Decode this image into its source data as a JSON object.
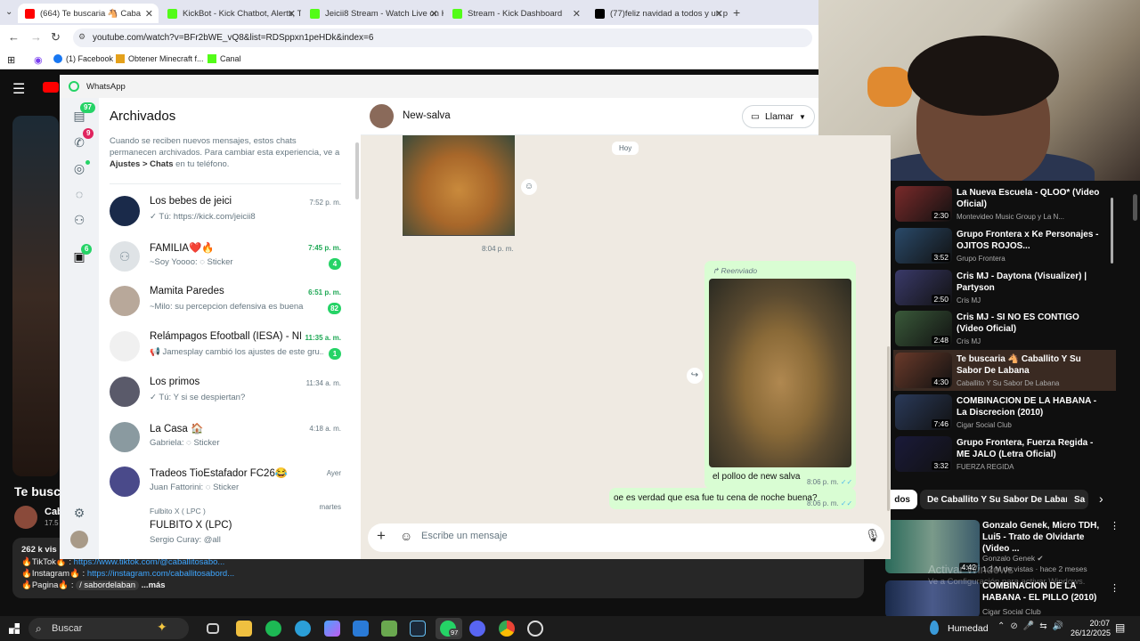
{
  "browser": {
    "tabs": [
      {
        "label": "(664) Te buscaria 🐴 Caba",
        "active": true,
        "color": "#ff0000"
      },
      {
        "label": "KickBot - Kick Chatbot, Alerts, T",
        "active": false,
        "color": "#53fc18"
      },
      {
        "label": "Jeicii8 Stream - Watch Live on K",
        "active": false,
        "color": "#53fc18"
      },
      {
        "label": "Stream - Kick Dashboard",
        "active": false,
        "color": "#53fc18"
      },
      {
        "label": "(77)feliz navidad a todos y un p",
        "active": false,
        "color": "#000000"
      }
    ],
    "url": "youtube.com/watch?v=BFr2bWE_vQ8&list=RDSppxn1peHDk&index=6",
    "bookmarks": [
      "(1) Facebook",
      "Obtener Minecraft f...",
      "Canal"
    ]
  },
  "youtube": {
    "title": "Te busca",
    "channel": "Cab",
    "channel_sub": "17.5",
    "views": "262 k vis",
    "desc_lines": [
      {
        "prefix": "🔥TikTok🔥 : ",
        "link": "https://www.tiktok.com/@caballitosabo..."
      },
      {
        "prefix": "🔥Instagram🔥 : ",
        "link": "https://instagram.com/caballitosabord..."
      },
      {
        "prefix": "🔥Pagina🔥 : ",
        "link": "/ sabordelaban"
      }
    ],
    "more": "...más",
    "playlist": [
      {
        "title": "La Nueva Escuela - QLOO* (Video Oficial)",
        "channel": "Montevideo Music Group y La N...",
        "duration": "2:30",
        "active": false
      },
      {
        "title": "Grupo Frontera x Ke Personajes - OJITOS ROJOS...",
        "channel": "Grupo Frontera",
        "duration": "3:52",
        "active": false
      },
      {
        "title": "Cris MJ - Daytona (Visualizer) | Partyson",
        "channel": "Cris MJ",
        "duration": "2:50",
        "active": false
      },
      {
        "title": "Cris MJ - SI NO ES CONTIGO (Video Oficial)",
        "channel": "Cris MJ",
        "duration": "2:48",
        "active": false
      },
      {
        "title": "Te buscaria 🐴 Caballito Y Su Sabor De Labana",
        "channel": "Caballito Y Su Sabor De Labana",
        "duration": "4:30",
        "active": true
      },
      {
        "title": "COMBINACION DE LA HABANA - La Discrecion (2010)",
        "channel": "Cigar Social Club",
        "duration": "7:46",
        "active": false
      },
      {
        "title": "Grupo Frontera, Fuerza Regida - ME JALO (Letra Oficial)",
        "channel": "FUERZA REGIDA",
        "duration": "3:32",
        "active": false
      }
    ],
    "chips": [
      "dos",
      "De Caballito Y Su Sabor De Labana",
      "Sa"
    ],
    "recs": [
      {
        "title": "Gonzalo Genek, Micro TDH, Lui5 - Trato de Olvidarte (Video ...",
        "channel": "Gonzalo Genek ✔",
        "meta": "1.2 M de vistas · hace 2 meses",
        "duration": "4:42"
      },
      {
        "title": "COMBINACION DE LA HABANA - EL PILLO (2010)",
        "channel": "Cigar Social Club",
        "meta": "",
        "duration": ""
      }
    ],
    "watermark_1": "Activar Windows",
    "watermark_2": "Ve a Configuración para activar Windows."
  },
  "whatsapp": {
    "window_title": "WhatsApp",
    "rail": {
      "chats_badge": "97",
      "calls_badge": "9",
      "archived_badge": "6"
    },
    "archived_title": "Archivados",
    "archived_info_1": "Cuando se reciben nuevos mensajes, estos chats permanecen archivados. Para cambiar esta experiencia, ve a ",
    "archived_info_bold": "Ajustes > Chats",
    "archived_info_2": " en tu teléfono.",
    "chats": [
      {
        "name": "Los bebes de jeici",
        "time": "7:52 p. m.",
        "msg": "✓ Tú: https://kick.com/jeicii8",
        "badge": "",
        "time_green": false
      },
      {
        "name": "FAMILIA❤️🔥",
        "time": "7:45 p. m.",
        "msg": "~Soy Yoooo: ◌ Sticker",
        "badge": "4",
        "time_green": true
      },
      {
        "name": "Mamita Paredes",
        "time": "6:51 p. m.",
        "msg": "~Milo: su percepcion defensiva es buena",
        "badge": "82",
        "time_green": true
      },
      {
        "name": "Relámpagos Efootball (IESA) - NE...",
        "time": "11:35 a. m.",
        "msg": "📢 Jamesplay cambió los ajustes de este gru...",
        "badge": "1",
        "time_green": true
      },
      {
        "name": "Los primos",
        "time": "11:34 a. m.",
        "msg": "✓ Tú: Y si se despiertan?",
        "badge": "",
        "time_green": false
      },
      {
        "name": "La Casa 🏠",
        "time": "4:18 a. m.",
        "msg": "Gabriela: ◌ Sticker",
        "badge": "",
        "time_green": false
      },
      {
        "name": "Tradeos TioEstafador FC26😂",
        "time": "Ayer",
        "msg": "Juan Fattorini: ◌ Sticker",
        "badge": "",
        "time_green": false
      },
      {
        "name": "FULBITO X (LPC)",
        "time": "martes",
        "msg": "Sergio Curay: @all",
        "badge": "",
        "time_green": false,
        "sub": "Fulbito X ( LPC )"
      }
    ],
    "conversation": {
      "contact": "New-salva",
      "call_label": "Llamar",
      "date_pill": "Hoy",
      "img_time": "8:04 p. m.",
      "forwarded": "Reenviado",
      "caption": "el polloo de new salva",
      "caption_time": "8:06 p. m.",
      "msg2": "oe es verdad que esa fue tu cena de noche buena?",
      "msg2_time": "8:06 p. m.",
      "composer_placeholder": "Escribe un mensaje"
    }
  },
  "taskbar": {
    "search": "Buscar",
    "weather": "Humedad",
    "time": "20:07",
    "date": "26/12/2025",
    "whatsapp_badge": "97"
  }
}
